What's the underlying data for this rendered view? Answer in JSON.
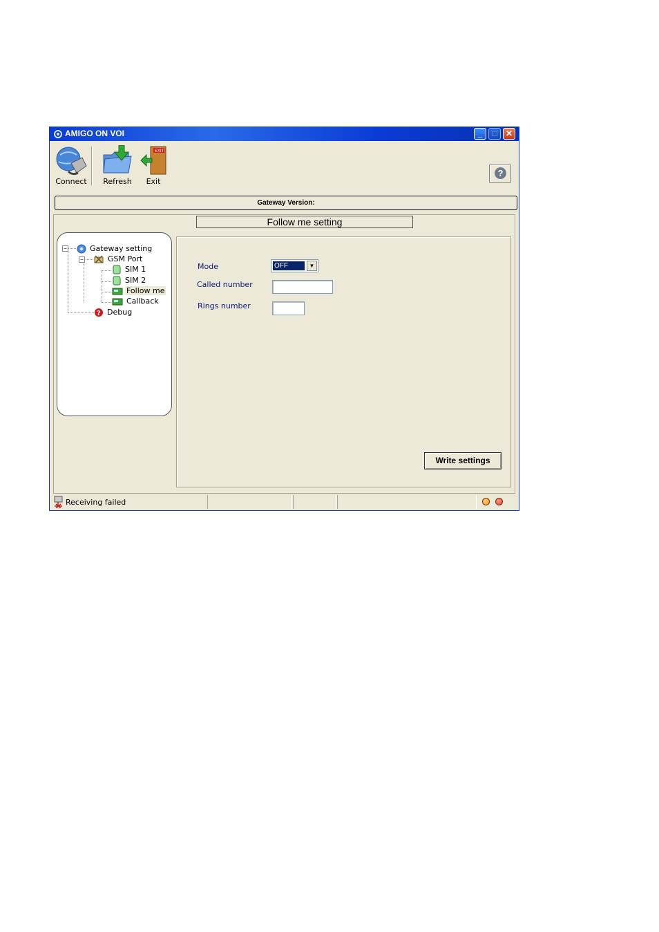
{
  "window": {
    "title": "AMIGO ON VOI",
    "minimize_symbol": "_",
    "maximize_symbol": "□",
    "close_symbol": "✕"
  },
  "toolbar": {
    "connect_label": "Connect",
    "refresh_label": "Refresh",
    "exit_label": "Exit",
    "help_symbol": "?",
    "connect_icon": "connect-plug-globe-icon",
    "refresh_icon": "folder-refresh-icon",
    "exit_icon": "exit-door-icon"
  },
  "version_bar": {
    "label": "Gateway Version:"
  },
  "panel": {
    "title": "Follow me setting"
  },
  "tree": {
    "root": "Gateway setting",
    "gsm_port": "GSM Port",
    "sim1": "SIM 1",
    "sim2": "SIM 2",
    "follow_me": "Follow me",
    "callback": "Callback",
    "debug": "Debug",
    "selected": "Follow me"
  },
  "form": {
    "mode_label": "Mode",
    "mode_value": "OFF",
    "called_number_label": "Called number",
    "called_number_value": "",
    "rings_number_label": "Rings number",
    "rings_number_value": "",
    "write_button": "Write settings"
  },
  "statusbar": {
    "text": "Receiving failed"
  },
  "colors": {
    "title_blue": "#0a3bd4",
    "window_bg": "#ece9d8",
    "label_blue": "#0b1a7a",
    "led_orange": "#f39a1e",
    "led_red": "#e23b2a"
  }
}
